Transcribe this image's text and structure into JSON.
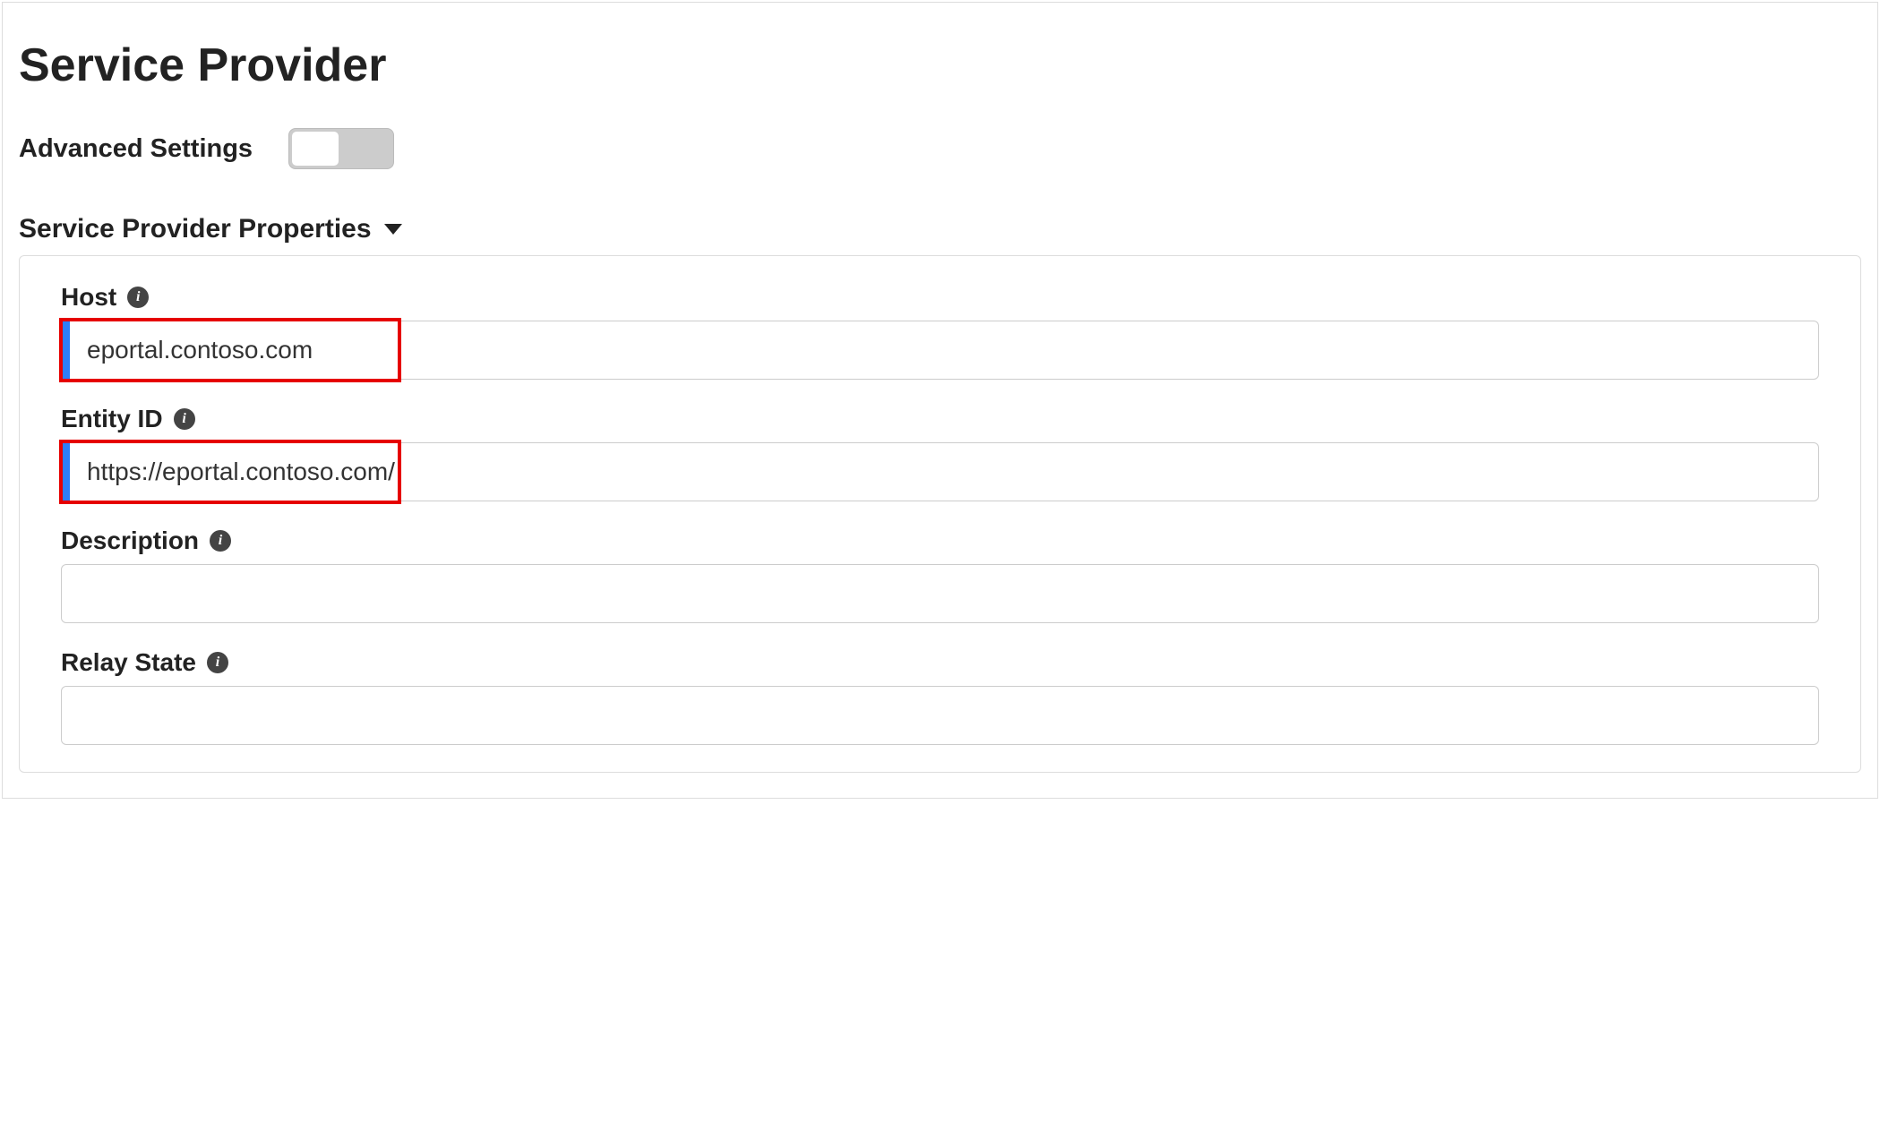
{
  "page": {
    "title": "Service Provider"
  },
  "advanced": {
    "label": "Advanced Settings"
  },
  "section": {
    "title": "Service Provider Properties"
  },
  "fields": {
    "host": {
      "label": "Host",
      "value": "eportal.contoso.com"
    },
    "entity_id": {
      "label": "Entity ID",
      "value": "https://eportal.contoso.com/"
    },
    "description": {
      "label": "Description",
      "value": ""
    },
    "relay_state": {
      "label": "Relay State",
      "value": ""
    }
  }
}
